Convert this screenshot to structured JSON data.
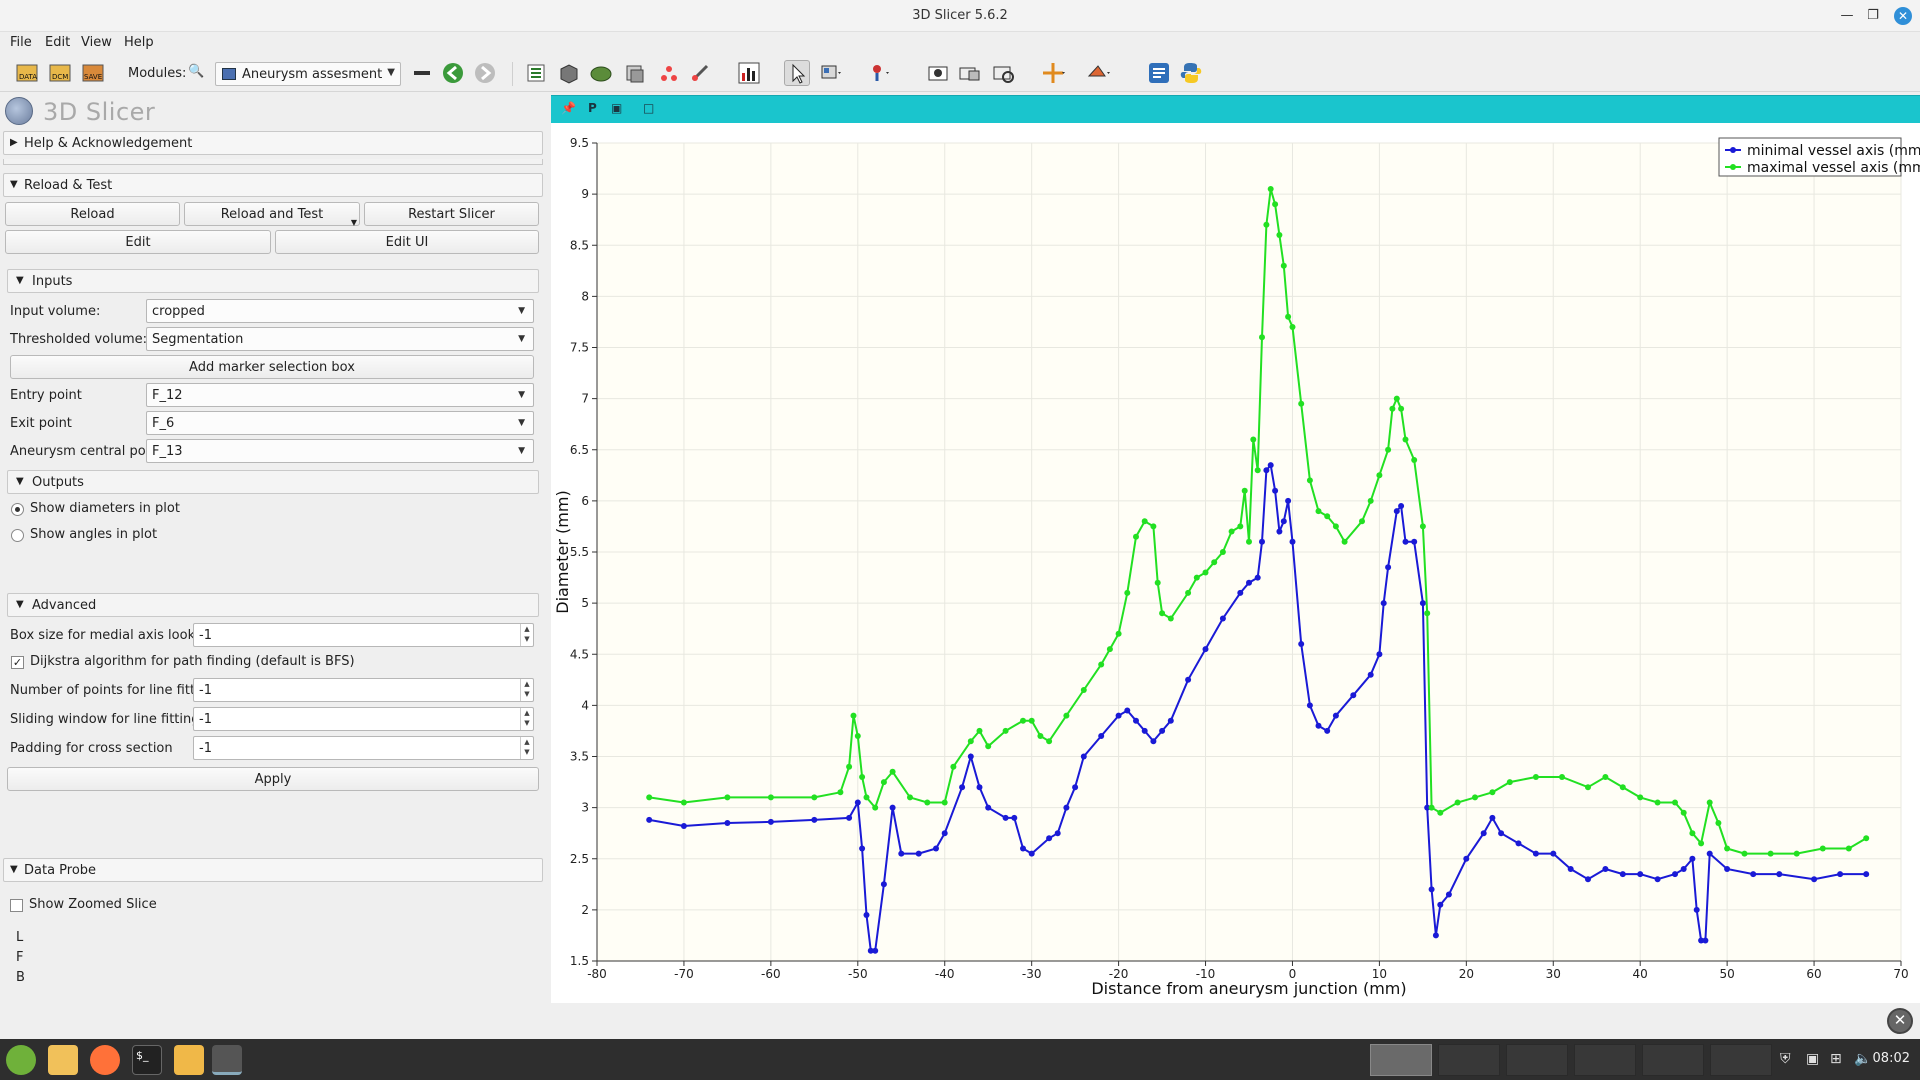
{
  "window": {
    "title": "3D Slicer 5.6.2"
  },
  "menu": [
    "File",
    "Edit",
    "View",
    "Help"
  ],
  "toolbar": {
    "modules_label": "Modules:",
    "module_selected": "Aneurysm assesment"
  },
  "panel": {
    "logo_text": "3D Slicer",
    "help_section": "Help & Acknowledgement",
    "reload_section": "Reload & Test",
    "buttons": {
      "reload": "Reload",
      "reload_test": "Reload and Test",
      "restart": "Restart Slicer",
      "edit": "Edit",
      "edit_ui": "Edit UI"
    },
    "inputs": {
      "header": "Inputs",
      "input_volume_label": "Input volume:",
      "input_volume": "cropped",
      "thresholded_label": "Thresholded volume:",
      "thresholded": "Segmentation",
      "add_marker": "Add marker selection box",
      "entry_label": "Entry point",
      "entry": "F_12",
      "exit_label": "Exit point",
      "exit": "F_6",
      "central_label": "Aneurysm central point",
      "central": "F_13"
    },
    "outputs": {
      "header": "Outputs",
      "show_diameters": "Show diameters in plot",
      "show_angles": "Show angles in plot"
    },
    "advanced": {
      "header": "Advanced",
      "box_size_label": "Box size for medial axis lookup",
      "box_size": "-1",
      "dijkstra_label": "Dijkstra algorithm for path finding (default is BFS)",
      "points_label": "Number of points for line fitting",
      "points": "-1",
      "window_label": "Sliding window for line fitting",
      "window": "-1",
      "padding_label": "Padding  for cross section",
      "padding": "-1",
      "apply": "Apply"
    },
    "data_probe": {
      "header": "Data Probe",
      "zoomed": "Show Zoomed Slice",
      "l": "L",
      "f": "F",
      "b": "B"
    }
  },
  "viewer": {
    "label_p": "P"
  },
  "taskbar": {
    "clock": "08:02"
  },
  "chart_data": {
    "type": "line",
    "title": "",
    "xlabel": "Distance from aneurysm junction (mm)",
    "ylabel": "Diameter (mm)",
    "xlim": [
      -80,
      70
    ],
    "ylim": [
      1.5,
      9.5
    ],
    "xticks": [
      -80,
      -70,
      -60,
      -50,
      -40,
      -30,
      -20,
      -10,
      0,
      10,
      20,
      30,
      40,
      50,
      60,
      70
    ],
    "yticks": [
      1.5,
      2,
      2.5,
      3,
      3.5,
      4,
      4.5,
      5,
      5.5,
      6,
      6.5,
      7,
      7.5,
      8,
      8.5,
      9,
      9.5
    ],
    "legend_position": "top-right",
    "series": [
      {
        "name": "minimal vessel axis (mm)",
        "color": "#1a1ad6",
        "x": [
          -74,
          -70,
          -65,
          -60,
          -55,
          -51,
          -50,
          -49.5,
          -49,
          -48.5,
          -48,
          -47,
          -46,
          -45,
          -43,
          -41,
          -40,
          -38,
          -37,
          -36,
          -35,
          -33,
          -32,
          -31,
          -30,
          -28,
          -27,
          -26,
          -25,
          -24,
          -22,
          -20,
          -19,
          -18,
          -17,
          -16,
          -15,
          -14,
          -12,
          -10,
          -8,
          -6,
          -5,
          -4,
          -3.5,
          -3,
          -2.5,
          -2,
          -1.5,
          -1,
          -0.5,
          0,
          1,
          2,
          3,
          4,
          5,
          7,
          9,
          10,
          10.5,
          11,
          12,
          12.5,
          13,
          14,
          15,
          15.5,
          16,
          16.5,
          17,
          18,
          20,
          22,
          23,
          24,
          26,
          28,
          30,
          32,
          34,
          36,
          38,
          40,
          42,
          44,
          45,
          46,
          46.5,
          47,
          47.5,
          48,
          50,
          53,
          56,
          60,
          63,
          66
        ],
        "y": [
          2.88,
          2.82,
          2.85,
          2.86,
          2.88,
          2.9,
          3.05,
          2.6,
          1.95,
          1.6,
          1.6,
          2.25,
          3.0,
          2.55,
          2.55,
          2.6,
          2.75,
          3.2,
          3.5,
          3.2,
          3.0,
          2.9,
          2.9,
          2.6,
          2.55,
          2.7,
          2.75,
          3.0,
          3.2,
          3.5,
          3.7,
          3.9,
          3.95,
          3.85,
          3.75,
          3.65,
          3.75,
          3.85,
          4.25,
          4.55,
          4.85,
          5.1,
          5.2,
          5.25,
          5.6,
          6.3,
          6.35,
          6.1,
          5.7,
          5.8,
          6.0,
          5.6,
          4.6,
          4.0,
          3.8,
          3.75,
          3.9,
          4.1,
          4.3,
          4.5,
          5.0,
          5.35,
          5.9,
          5.95,
          5.6,
          5.6,
          5.0,
          3.0,
          2.2,
          1.75,
          2.05,
          2.15,
          2.5,
          2.75,
          2.9,
          2.75,
          2.65,
          2.55,
          2.55,
          2.4,
          2.3,
          2.4,
          2.35,
          2.35,
          2.3,
          2.35,
          2.4,
          2.5,
          2.0,
          1.7,
          1.7,
          2.55,
          2.4,
          2.35,
          2.35,
          2.3,
          2.35,
          2.35
        ]
      },
      {
        "name": "maximal vessel axis (mm)",
        "color": "#22e022",
        "x": [
          -74,
          -70,
          -65,
          -60,
          -55,
          -52,
          -51,
          -50.5,
          -50,
          -49.5,
          -49,
          -48,
          -47,
          -46,
          -44,
          -42,
          -40,
          -39,
          -37,
          -36,
          -35,
          -33,
          -31,
          -30,
          -29,
          -28,
          -26,
          -24,
          -22,
          -21,
          -20,
          -19,
          -18,
          -17,
          -16,
          -15.5,
          -15,
          -14,
          -12,
          -11,
          -10,
          -9,
          -8,
          -7,
          -6,
          -5.5,
          -5,
          -4.5,
          -4,
          -3.5,
          -3,
          -2.5,
          -2,
          -1.5,
          -1,
          -0.5,
          0,
          1,
          2,
          3,
          4,
          5,
          6,
          8,
          9,
          10,
          11,
          11.5,
          12,
          12.5,
          13,
          14,
          15,
          15.5,
          16,
          17,
          19,
          21,
          23,
          25,
          28,
          31,
          34,
          36,
          38,
          40,
          42,
          44,
          45,
          46,
          47,
          48,
          49,
          50,
          52,
          55,
          58,
          61,
          64,
          66
        ],
        "y": [
          3.1,
          3.05,
          3.1,
          3.1,
          3.1,
          3.15,
          3.4,
          3.9,
          3.7,
          3.3,
          3.1,
          3.0,
          3.25,
          3.35,
          3.1,
          3.05,
          3.05,
          3.4,
          3.65,
          3.75,
          3.6,
          3.75,
          3.85,
          3.85,
          3.7,
          3.65,
          3.9,
          4.15,
          4.4,
          4.55,
          4.7,
          5.1,
          5.65,
          5.8,
          5.75,
          5.2,
          4.9,
          4.85,
          5.1,
          5.25,
          5.3,
          5.4,
          5.5,
          5.7,
          5.75,
          6.1,
          5.6,
          6.6,
          6.3,
          7.6,
          8.7,
          9.05,
          8.9,
          8.6,
          8.3,
          7.8,
          7.7,
          6.95,
          6.2,
          5.9,
          5.85,
          5.75,
          5.6,
          5.8,
          6.0,
          6.25,
          6.5,
          6.9,
          7.0,
          6.9,
          6.6,
          6.4,
          5.75,
          4.9,
          3.0,
          2.95,
          3.05,
          3.1,
          3.15,
          3.25,
          3.3,
          3.3,
          3.2,
          3.3,
          3.2,
          3.1,
          3.05,
          3.05,
          2.95,
          2.75,
          2.65,
          3.05,
          2.85,
          2.6,
          2.55,
          2.55,
          2.55,
          2.6,
          2.6,
          2.7
        ]
      }
    ]
  }
}
